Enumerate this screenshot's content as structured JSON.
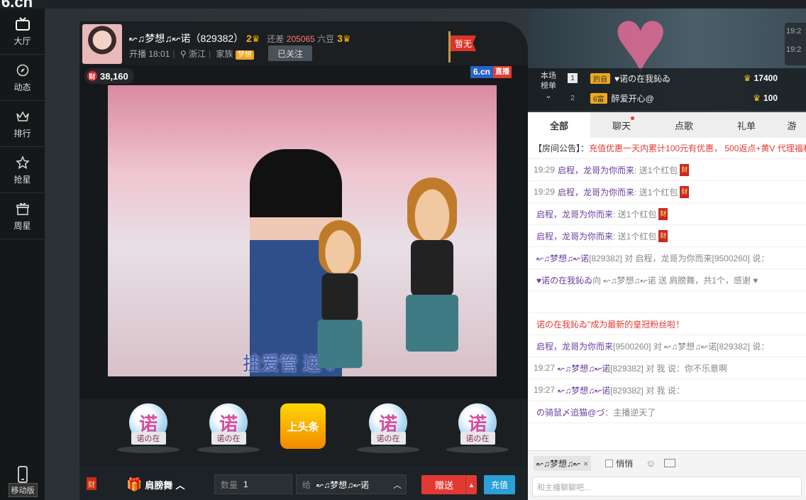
{
  "site": {
    "logo": "6.cn"
  },
  "nav": {
    "items": [
      {
        "label": "大厅",
        "icon": "tv-icon"
      },
      {
        "label": "动态",
        "icon": "compass-icon"
      },
      {
        "label": "排行",
        "icon": "crown-icon"
      },
      {
        "label": "抢星",
        "icon": "star-icon"
      },
      {
        "label": "周星",
        "icon": "gift-icon"
      }
    ],
    "mobile": "移动版"
  },
  "host": {
    "name": "↜♫梦想♫↜诺（829382）",
    "level1": "2",
    "gap_label": "还差",
    "gap_value": "205065",
    "gap_unit": "六豆",
    "level2": "3",
    "start_label": "开播 18:01",
    "location": "浙江",
    "family_label": "家族",
    "family_tag": "梦想",
    "follow_label": "已关注",
    "flag_label": "暂无"
  },
  "video": {
    "wealth": "38,160",
    "wealth_icon": "财",
    "brand": "6.cn",
    "brand_live": "直播",
    "overlay_text": "挂爱管  送 0"
  },
  "gifts": [
    {
      "char": "诺",
      "label": "诺の在"
    },
    {
      "char": "诺",
      "label": "诺の在"
    },
    {
      "char": "上头条",
      "label": ""
    },
    {
      "char": "诺",
      "label": "诺の在"
    },
    {
      "char": "诺",
      "label": "诺の在"
    }
  ],
  "footer": {
    "cai": "财",
    "gift_name": "肩膀舞",
    "qty_label": "数量",
    "qty_value": "1",
    "to_label": "给",
    "to_value": "↜♫梦想♫↜诺",
    "send_label": "赠送",
    "charge_label": "充值"
  },
  "right": {
    "times": [
      "19:2",
      "19:2"
    ],
    "rank_label": "本场榜单",
    "rank": [
      {
        "n": "1",
        "badge": "的自",
        "name": "♥诺の在我鈊ゐ",
        "score": "17400"
      },
      {
        "n": "2",
        "badge": "6富",
        "name": "醉爱开心@",
        "score": "100"
      }
    ]
  },
  "tabs": [
    "全部",
    "聊天",
    "点歌",
    "礼单",
    "游"
  ],
  "chat": {
    "notice_prefix": "【房间公告】：",
    "notice_text": "充值优惠一天内累计100元有优惠， 500返点+黄V 代理福利",
    "messages": [
      {
        "t": "19:29",
        "u": "启程，龙哥为你而来",
        "r": ": 送1个红包",
        "rp": true
      },
      {
        "t": "19:29",
        "u": "启程，龙哥为你而来",
        "r": ": 送1个红包",
        "rp": true
      },
      {
        "t": "",
        "u": "启程，龙哥为你而来",
        "r": ": 送1个红包",
        "rp": true
      },
      {
        "t": "",
        "u": "启程，龙哥为你而来",
        "r": ": 送1个红包",
        "rp": true
      },
      {
        "t": "",
        "u": "↜♫梦想♫↜诺",
        "r": "[829382] 对 启程，龙哥为你而来[9500260] 说：",
        "rp": false
      },
      {
        "t": "",
        "u": "♥诺の在我鈊ゐ",
        "r": " 向 ↜♫梦想♫↜诺 送   肩膀舞，共1个，感谢 ♥",
        "rp": false
      },
      {
        "t": "",
        "u": "",
        "r": "",
        "rp": false
      },
      {
        "t": "",
        "u": "",
        "r": "诺の在我鈊ゐ\"成为最新的皇冠粉丝啦！",
        "rp": false,
        "red": true
      },
      {
        "t": "",
        "u": "启程，龙哥为你而来",
        "r": "[9500260] 对 ↜♫梦想♫↜诺[829382] 说：",
        "rp": false
      },
      {
        "t": "19:27",
        "u": "↜♫梦想♫↜诺",
        "r": "[829382] 对 我 说：你不乐意啊",
        "rp": false
      },
      {
        "t": "19:27",
        "u": "↜♫梦想♫↜诺",
        "r": "[829382] 对 我 说：",
        "rp": false
      },
      {
        "t": "",
        "u": "の骑鼠〆追猫@づ",
        "r": "：主播逆天了",
        "rp": false
      }
    ]
  },
  "input": {
    "chip": "↜♫梦想♫↜",
    "quiet": "悄悄",
    "placeholder": "和主播聊聊吧..."
  }
}
